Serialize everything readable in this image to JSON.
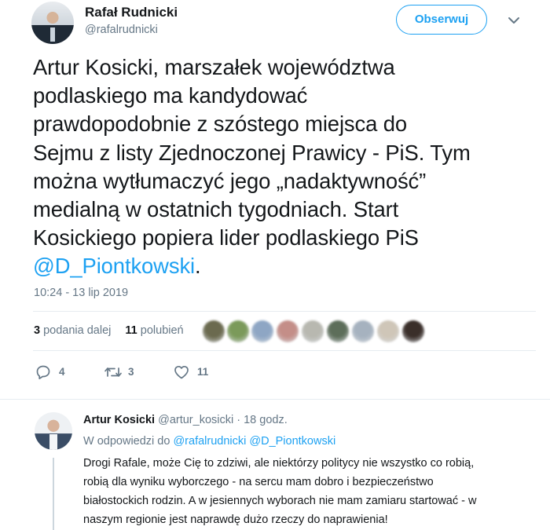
{
  "tweet": {
    "author_name": "Rafał Rudnicki",
    "author_handle": "@rafalrudnicki",
    "follow_label": "Obserwuj",
    "text_lines": [
      "Artur Kosicki, marszałek województwa",
      "podlaskiego ma kandydować",
      "prawdopodobnie z szóstego miejsca do",
      "Sejmu z listy Zjednoczonej Prawicy - PiS. Tym",
      "można wytłumaczyć jego „nadaktywność”",
      "medialną w ostatnich tygodniach. Start",
      "Kosickiego popiera lider podlaskiego PiS"
    ],
    "mention": "@D_Piontkowski",
    "text_end": ".",
    "timestamp": "10:24 - 13 lip 2019",
    "retweet_count": "3",
    "retweet_label": "podania dalej",
    "like_count": "11",
    "like_label": "polubień",
    "actions": {
      "reply_count": "4",
      "retweet_count": "3",
      "like_count": "11"
    },
    "likers": [
      {
        "color": "#6b6a4f"
      },
      {
        "color": "#7b9a5a"
      },
      {
        "color": "#8ea6c4"
      },
      {
        "color": "#c48e88"
      },
      {
        "color": "#b8b8b0"
      },
      {
        "color": "#5d6e5a"
      },
      {
        "color": "#a6b2bf"
      },
      {
        "color": "#cfc6b8"
      },
      {
        "color": "#3a2f2a"
      }
    ]
  },
  "reply": {
    "author_name": "Artur Kosicki",
    "author_handle": "@artur_kosicki",
    "separator": "·",
    "time": "18 godz.",
    "in_reply_to_label": "W odpowiedzi do",
    "in_reply_to_1": "@rafalrudnicki",
    "in_reply_to_2": "@D_Piontkowski",
    "text_lines": [
      "Drogi Rafale, może Cię to zdziwi, ale niektórzy politycy nie wszystko co robią,",
      "robią dla wyniku wyborczego - na sercu mam dobro i bezpieczeństwo",
      "białostockich rodzin. A w jesiennych wyborach nie mam zamiaru startować - w",
      "naszym regionie jest naprawdę dużo rzeczy do naprawienia!"
    ]
  },
  "colors": {
    "accent": "#1da1f2",
    "muted": "#657786",
    "text": "#14171a",
    "divider": "#e6ecf0"
  }
}
